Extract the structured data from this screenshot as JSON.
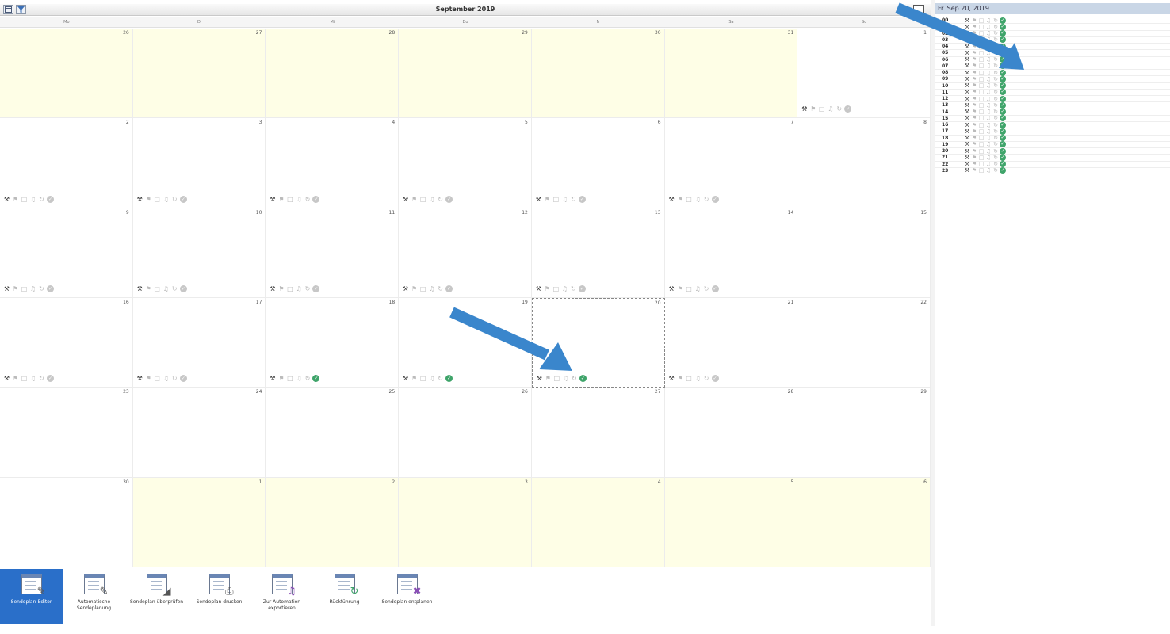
{
  "calendar": {
    "title": "September 2019",
    "weekdays": [
      "Mo",
      "Di",
      "Mi",
      "Do",
      "Fr",
      "Sa",
      "So"
    ],
    "days": [
      {
        "n": "26",
        "other": true
      },
      {
        "n": "27",
        "other": true
      },
      {
        "n": "28",
        "other": true
      },
      {
        "n": "29",
        "other": true
      },
      {
        "n": "30",
        "other": true
      },
      {
        "n": "31",
        "other": true
      },
      {
        "n": "1",
        "other": false,
        "icons": true
      },
      {
        "n": "2",
        "icons": true
      },
      {
        "n": "3",
        "icons": true
      },
      {
        "n": "4",
        "icons": true
      },
      {
        "n": "5",
        "icons": true
      },
      {
        "n": "6",
        "icons": true
      },
      {
        "n": "7",
        "icons": true
      },
      {
        "n": "8"
      },
      {
        "n": "9",
        "icons": true
      },
      {
        "n": "10",
        "icons": true
      },
      {
        "n": "11",
        "icons": true
      },
      {
        "n": "12",
        "icons": true
      },
      {
        "n": "13",
        "icons": true
      },
      {
        "n": "14",
        "icons": true
      },
      {
        "n": "15"
      },
      {
        "n": "16",
        "icons": true
      },
      {
        "n": "17",
        "icons": true
      },
      {
        "n": "18",
        "icons": true,
        "ok": true
      },
      {
        "n": "19",
        "icons": true,
        "ok": true
      },
      {
        "n": "20",
        "icons": true,
        "ok": true,
        "today": true
      },
      {
        "n": "21",
        "icons": true
      },
      {
        "n": "22"
      },
      {
        "n": "23"
      },
      {
        "n": "24"
      },
      {
        "n": "25"
      },
      {
        "n": "26"
      },
      {
        "n": "27"
      },
      {
        "n": "28"
      },
      {
        "n": "29"
      },
      {
        "n": "30"
      },
      {
        "n": "1",
        "other": true
      },
      {
        "n": "2",
        "other": true
      },
      {
        "n": "3",
        "other": true
      },
      {
        "n": "4",
        "other": true
      },
      {
        "n": "5",
        "other": true
      },
      {
        "n": "6",
        "other": true
      }
    ]
  },
  "toolbar": [
    {
      "label": "Sendeplan-Editor",
      "icon": "editor-icon",
      "active": true
    },
    {
      "label": "Automatische Sendeplanung",
      "icon": "auto-plan-icon"
    },
    {
      "label": "Sendeplan überprüfen",
      "icon": "check-plan-icon"
    },
    {
      "label": "Sendeplan drucken",
      "icon": "print-icon"
    },
    {
      "label": "Zur Automation exportieren",
      "icon": "export-icon"
    },
    {
      "label": "Rückführung",
      "icon": "return-icon"
    },
    {
      "label": "Sendeplan entplanen",
      "icon": "unplan-icon"
    }
  ],
  "side": {
    "date": "Fr. Sep 20, 2019",
    "hours": [
      "00",
      "01",
      "02",
      "03",
      "04",
      "05",
      "06",
      "07",
      "08",
      "09",
      "10",
      "11",
      "12",
      "13",
      "14",
      "15",
      "16",
      "17",
      "18",
      "19",
      "20",
      "21",
      "22",
      "23"
    ]
  },
  "colors": {
    "accent": "#2a6fc9",
    "ok": "#3fa46a",
    "arrow": "#3a86cc",
    "other_month": "#fefee6"
  }
}
